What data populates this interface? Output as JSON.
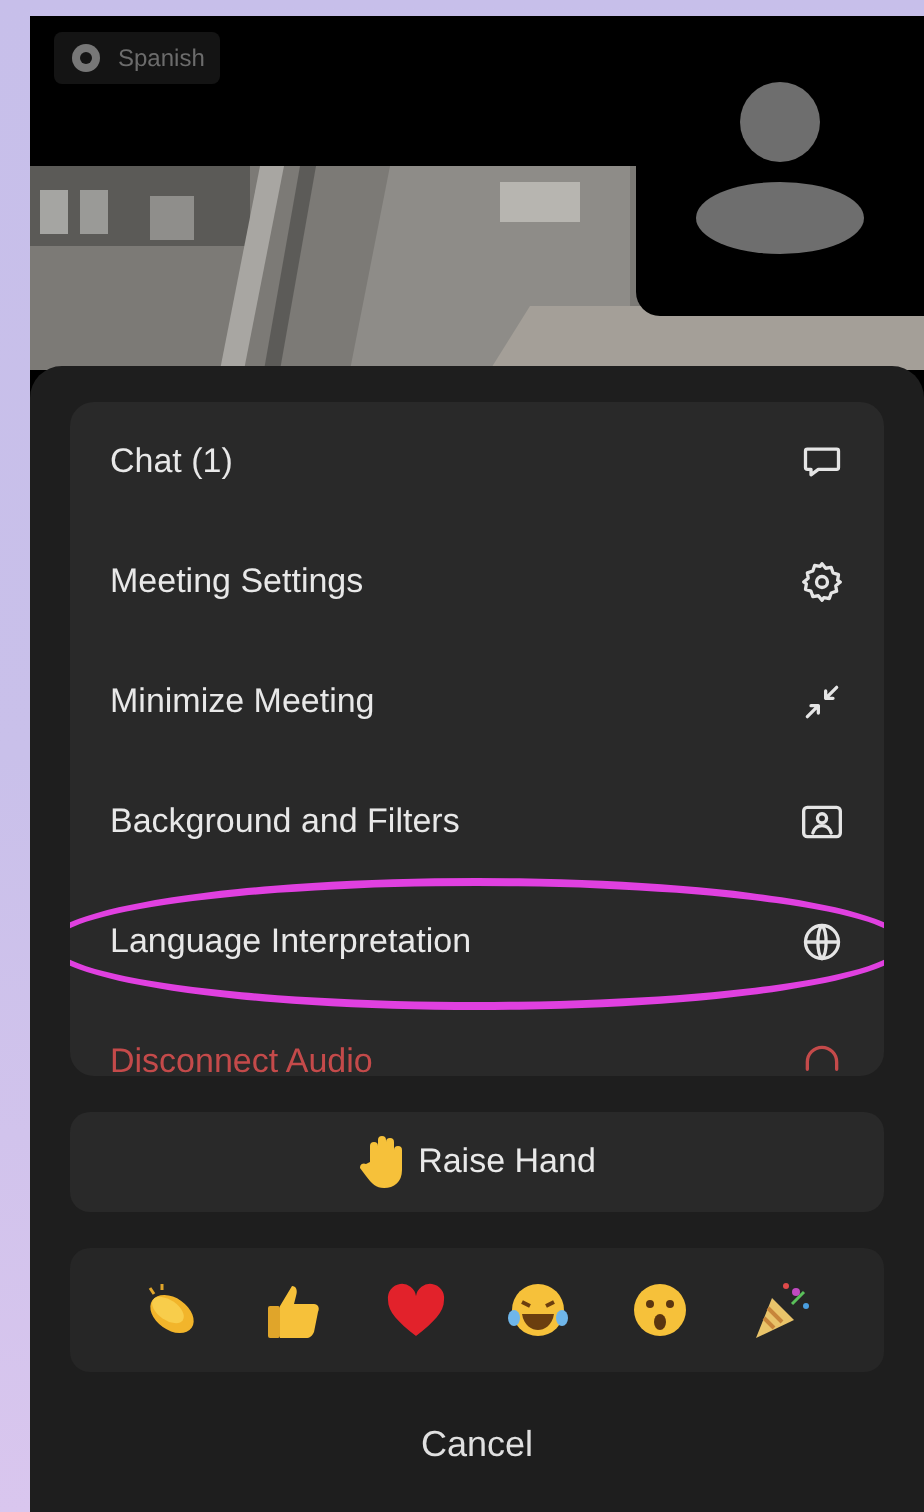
{
  "language_badge": {
    "label": "Spanish"
  },
  "menu": [
    {
      "label": "Chat (1)",
      "kind": "chat",
      "danger": false,
      "highlighted": false
    },
    {
      "label": "Meeting Settings",
      "kind": "settings",
      "danger": false,
      "highlighted": false
    },
    {
      "label": "Minimize Meeting",
      "kind": "minimize",
      "danger": false,
      "highlighted": false
    },
    {
      "label": "Background and Filters",
      "kind": "background",
      "danger": false,
      "highlighted": false
    },
    {
      "label": "Language Interpretation",
      "kind": "globe",
      "danger": false,
      "highlighted": true
    },
    {
      "label": "Disconnect Audio",
      "kind": "disconnect",
      "danger": true,
      "highlighted": false
    }
  ],
  "raise_hand": {
    "label": "Raise Hand"
  },
  "reactions": [
    {
      "kind": "clap"
    },
    {
      "kind": "thumbs"
    },
    {
      "kind": "heart"
    },
    {
      "kind": "laugh"
    },
    {
      "kind": "surprised"
    },
    {
      "kind": "party"
    }
  ],
  "cancel": {
    "label": "Cancel"
  }
}
